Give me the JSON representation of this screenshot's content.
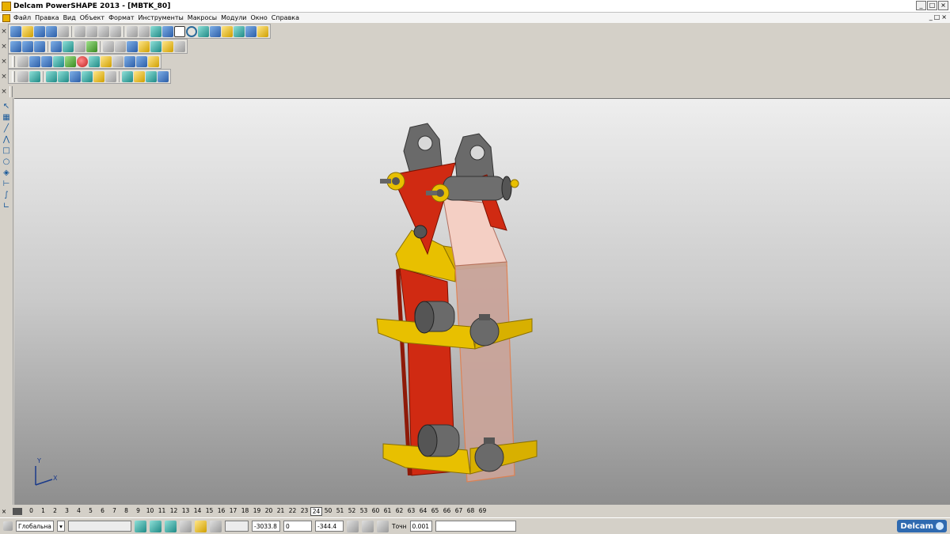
{
  "window": {
    "title": "Delcam PowerSHAPE 2013 - [MBTK_80]",
    "controls": [
      "_",
      "□",
      "×"
    ]
  },
  "menu": {
    "items": [
      "Файл",
      "Правка",
      "Вид",
      "Объект",
      "Формат",
      "Инструменты",
      "Макросы",
      "Модули",
      "Окно",
      "Справка"
    ],
    "mdi_controls": [
      "_",
      "□",
      "×"
    ]
  },
  "toolbars": {
    "close_glyph": "×",
    "row1_icons": [
      "new-icon",
      "open-icon",
      "save-icon",
      "save-as-icon",
      "print-icon",
      "cut-icon",
      "copy-icon",
      "paste-icon",
      "delete-icon",
      "undo-icon",
      "redo-icon",
      "select-icon",
      "line-icon",
      "circle-icon",
      "arc-icon",
      "text-icon",
      "surface-icon",
      "solid-icon",
      "wizard-icon"
    ],
    "row2_icons": [
      "view-top-icon",
      "view-front-icon",
      "view-iso-icon",
      "view-wire-icon",
      "zoom-in-icon",
      "zoom-out-icon",
      "zoom-all-icon",
      "pan-icon",
      "globe-icon",
      "shade-icon",
      "render-icon",
      "light-icon"
    ],
    "row3_icons": [
      "level-icon",
      "doc-icon",
      "model-icon",
      "shade-green-icon",
      "shade-red-icon",
      "arrow-icon",
      "box-icon",
      "grid-icon",
      "layers-icon",
      "cube-icon",
      "toolpath-icon"
    ],
    "row4_icons": [
      "surface-icon",
      "x-icon",
      "solid-box-icon",
      "solid-extrude-icon",
      "solid-revolve-icon",
      "solid-blend-icon",
      "solid-feature-icon",
      "solid-shell-icon",
      "solid-boolean-icon",
      "solid-tree-icon",
      "solid-history-icon",
      "solid-color-icon"
    ]
  },
  "left_tools": [
    "select-arrow-icon",
    "plane-icon",
    "line-tool-icon",
    "polyline-icon",
    "rectangle-icon",
    "circle-tool-icon",
    "solid-tool-icon",
    "dimension-icon",
    "curve-icon",
    "angle-icon"
  ],
  "viewport": {
    "axis_y": "Y",
    "axis_x": "X",
    "colors": {
      "red": "#d02a12",
      "yellow": "#e8c000",
      "gray": "#6a6a6a",
      "pink": "#f4cfc4",
      "clear": "#c9a49a"
    }
  },
  "levels": {
    "items": [
      "0",
      "1",
      "2",
      "3",
      "4",
      "5",
      "6",
      "7",
      "8",
      "9",
      "10",
      "11",
      "12",
      "13",
      "14",
      "15",
      "16",
      "17",
      "18",
      "19",
      "20",
      "21",
      "22",
      "23",
      "24",
      "50",
      "51",
      "52",
      "53",
      "60",
      "61",
      "62",
      "63",
      "64",
      "65",
      "66",
      "67",
      "68",
      "69"
    ],
    "active": "24"
  },
  "status": {
    "workplane": "Глобальна",
    "x": "-3033.8",
    "y": "0",
    "z": "-344.4",
    "tol_label": "Точн",
    "tolerance": "0.001",
    "brand": "Delcam"
  }
}
